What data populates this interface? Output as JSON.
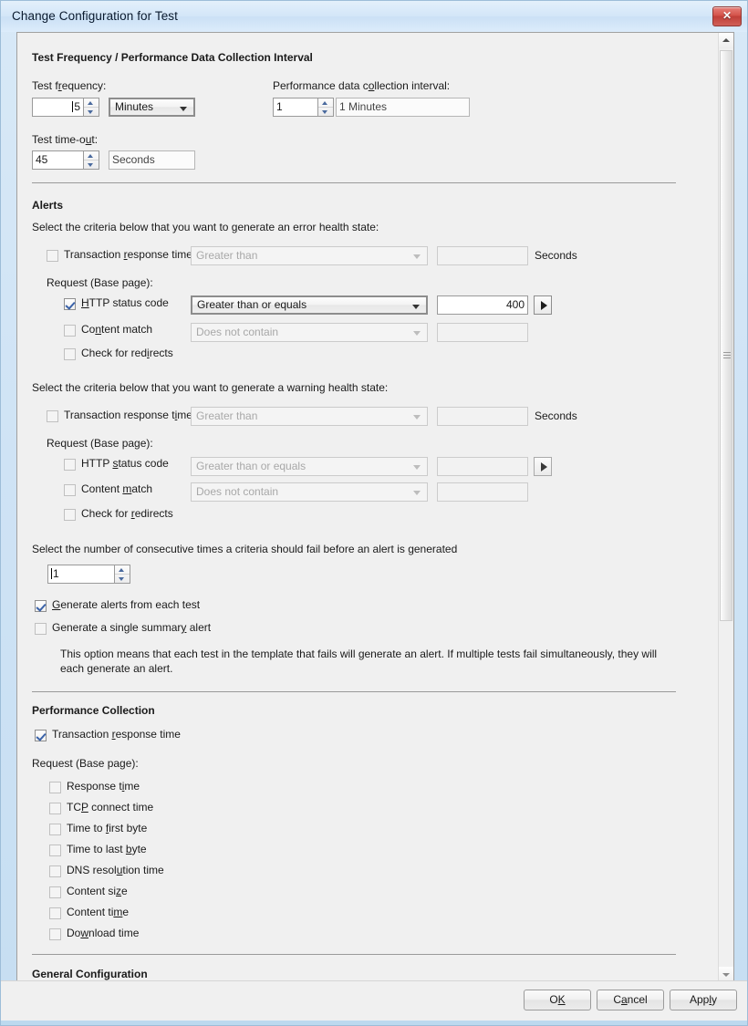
{
  "window": {
    "title": "Change Configuration for Test",
    "close_label": "✕"
  },
  "frequency_section": {
    "heading": "Test Frequency / Performance Data Collection Interval",
    "test_frequency_label": "Test frequency:",
    "test_frequency_value": "5",
    "test_frequency_unit": "Minutes",
    "perf_interval_label": "Performance data collection interval:",
    "perf_interval_value": "1",
    "perf_interval_unit": "1 Minutes",
    "test_timeout_label": "Test time-out:",
    "test_timeout_value": "45",
    "test_timeout_unit": "Seconds"
  },
  "alerts_section": {
    "heading": "Alerts",
    "error_intro": "Select the criteria below that you want to generate an error health state:",
    "warning_intro": "Select the criteria below that you want to generate a warning health state:",
    "request_label": "Request (Base page):",
    "seconds_label": "Seconds",
    "error": {
      "transaction_response_time": {
        "label": "Transaction response time",
        "checked": false,
        "operator": "Greater than",
        "value": ""
      },
      "http_status_code": {
        "label": "HTTP status code",
        "checked": true,
        "operator": "Greater than or equals",
        "value": "400"
      },
      "content_match": {
        "label": "Content match",
        "checked": false,
        "operator": "Does not contain",
        "value": ""
      },
      "check_for_redirects": {
        "label": "Check for redirects",
        "checked": false
      }
    },
    "warning": {
      "transaction_response_time": {
        "label": "Transaction response time",
        "checked": false,
        "operator": "Greater than",
        "value": ""
      },
      "http_status_code": {
        "label": "HTTP status code",
        "checked": false,
        "operator": "Greater than or equals",
        "value": ""
      },
      "content_match": {
        "label": "Content match",
        "checked": false,
        "operator": "Does not contain",
        "value": ""
      },
      "check_for_redirects": {
        "label": "Check for redirects",
        "checked": false
      }
    },
    "consecutive_label": "Select the number of consecutive times a criteria should fail before an alert is generated",
    "consecutive_value": "1",
    "generate_each_test": {
      "label": "Generate alerts from each test",
      "checked": true
    },
    "generate_summary": {
      "label": "Generate a single summary alert",
      "checked": false
    },
    "option_description": "This option means that each test in the template that fails will generate an alert. If multiple tests fail simultaneously, they will each generate an alert."
  },
  "performance_section": {
    "heading": "Performance Collection",
    "transaction_response_time": {
      "label": "Transaction response time",
      "checked": true
    },
    "request_label": "Request (Base page):",
    "metrics": [
      {
        "label": "Response time",
        "checked": false
      },
      {
        "label": "TCP connect time",
        "checked": false
      },
      {
        "label": "Time to first byte",
        "checked": false
      },
      {
        "label": "Time to last byte",
        "checked": false
      },
      {
        "label": "DNS resolution time",
        "checked": false
      },
      {
        "label": "Content size",
        "checked": false
      },
      {
        "label": "Content time",
        "checked": false
      },
      {
        "label": "Download time",
        "checked": false
      }
    ]
  },
  "general_section": {
    "heading": "General Configuration"
  },
  "buttons": {
    "ok": "OK",
    "cancel": "Cancel",
    "apply": "Apply"
  }
}
